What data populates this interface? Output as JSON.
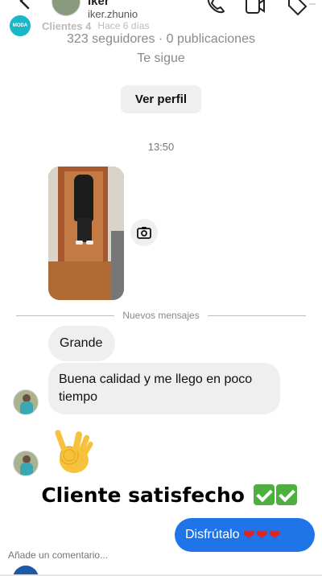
{
  "story": {
    "progress": 0.98,
    "user": "Clientes 4",
    "time": "Hace 6 días",
    "avatar_text": "MODA",
    "comment_placeholder": "Añade un comentario...",
    "caption": "Cliente satisfecho",
    "caption_emoji": [
      "check-mark-button",
      "check-mark-button"
    ]
  },
  "dm_header": {
    "name": "iker",
    "handle": "iker.zhunio",
    "icons": [
      "phone-icon",
      "video-icon",
      "tag-icon"
    ]
  },
  "profile": {
    "followers": "323 seguidores · 0 publicaciones",
    "follows_you": "Te sigue",
    "view_profile_label": "Ver perfil"
  },
  "conversation": {
    "timestamp": "13:50",
    "new_messages_label": "Nuevos mensajes",
    "messages": [
      {
        "from": "other",
        "text": "Grande"
      },
      {
        "from": "other",
        "text": "Buena calidad y me llego en poco tiempo"
      },
      {
        "from": "other",
        "emoji": "ok-hand"
      }
    ],
    "sent_reply": "Disfrútalo",
    "sent_reply_hearts": "❤❤❤"
  },
  "colors": {
    "accent_blue": "#1f74e8",
    "bubble_grey": "#efefef",
    "heart_red": "#e02424",
    "check_green": "#4caf3e"
  }
}
